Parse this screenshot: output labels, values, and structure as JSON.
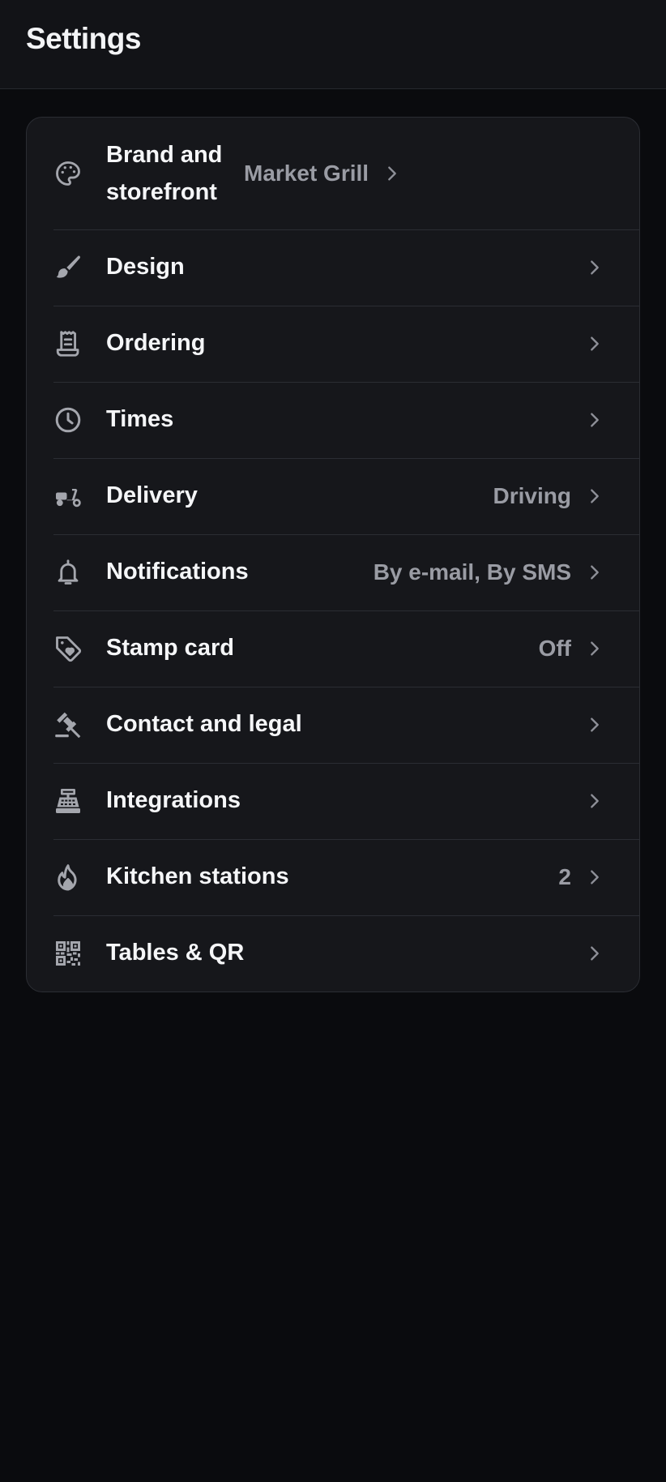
{
  "header": {
    "title": "Settings"
  },
  "colors": {
    "background": "#0a0b0e",
    "card": "#16171b",
    "text": "#f5f6f8",
    "muted": "#9a9ca4",
    "icon": "#a4a6ad"
  },
  "settings": {
    "items": [
      {
        "icon": "palette-icon",
        "label": "Brand and storefront",
        "value": "Market Grill"
      },
      {
        "icon": "brush-icon",
        "label": "Design",
        "value": ""
      },
      {
        "icon": "receipt-icon",
        "label": "Ordering",
        "value": ""
      },
      {
        "icon": "clock-icon",
        "label": "Times",
        "value": ""
      },
      {
        "icon": "scooter-icon",
        "label": "Delivery",
        "value": "Driving"
      },
      {
        "icon": "bell-icon",
        "label": "Notifications",
        "value": "By e-mail, By SMS"
      },
      {
        "icon": "tag-heart-icon",
        "label": "Stamp card",
        "value": "Off"
      },
      {
        "icon": "gavel-icon",
        "label": "Contact and legal",
        "value": ""
      },
      {
        "icon": "cash-register-icon",
        "label": "Integrations",
        "value": ""
      },
      {
        "icon": "flame-icon",
        "label": "Kitchen stations",
        "value": "2"
      },
      {
        "icon": "qr-code-icon",
        "label": "Tables & QR",
        "value": ""
      }
    ]
  }
}
